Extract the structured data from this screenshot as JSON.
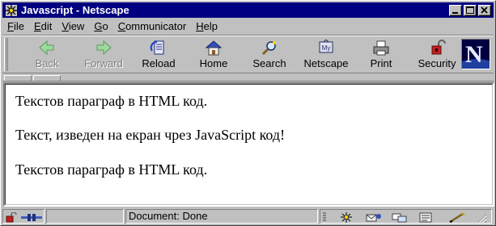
{
  "window": {
    "title": "Javascript - Netscape",
    "controls": [
      "minimize",
      "maximize",
      "close"
    ]
  },
  "menu": {
    "items": [
      {
        "label_underlined": "F",
        "label_rest": "ile"
      },
      {
        "label_underlined": "E",
        "label_rest": "dit"
      },
      {
        "label_underlined": "V",
        "label_rest": "iew"
      },
      {
        "label_underlined": "G",
        "label_rest": "o"
      },
      {
        "label_underlined": "C",
        "label_rest": "ommunicator"
      },
      {
        "label_underlined": "H",
        "label_rest": "elp"
      }
    ]
  },
  "toolbar": {
    "back": {
      "label": "Back",
      "icon": "back-arrow-icon",
      "enabled": false
    },
    "forward": {
      "label": "Forward",
      "icon": "forward-arrow-icon",
      "enabled": false
    },
    "reload": {
      "label": "Reload",
      "icon": "reload-icon"
    },
    "home": {
      "label": "Home",
      "icon": "home-icon"
    },
    "search": {
      "label": "Search",
      "icon": "search-icon"
    },
    "netscape": {
      "label": "Netscape",
      "icon": "netscape-icon"
    },
    "print": {
      "label": "Print",
      "icon": "print-icon"
    },
    "security": {
      "label": "Security",
      "icon": "padlock-icon"
    },
    "logo": {
      "letter": "N"
    }
  },
  "content": {
    "paragraphs": [
      "Текстов параграф в HTML код.",
      "Текст, изведен на екран чрез JavaScript код!",
      "Текстов параграф в HTML код."
    ]
  },
  "status": {
    "text": "Document: Done"
  },
  "colors": {
    "titlebar": "#000080",
    "chrome": "#c0c0c0",
    "content_bg": "#ffffff"
  }
}
